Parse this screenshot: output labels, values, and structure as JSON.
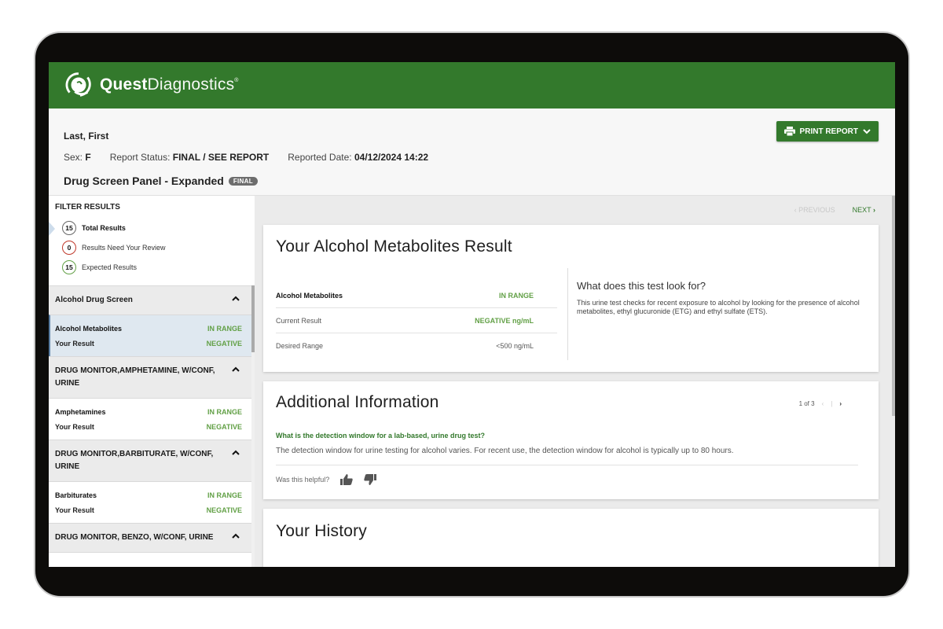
{
  "brand": {
    "name_bold": "Quest",
    "name_light": "Diagnostics",
    "trademark": "®",
    "primary_color": "#33792c",
    "in_range_color": "#62a046"
  },
  "patient": {
    "name": "Last, First",
    "sex_label": "Sex:",
    "sex_value": "F",
    "status_label": "Report Status:",
    "status_value": "FINAL / SEE REPORT",
    "date_label": "Reported Date:",
    "date_value": "04/12/2024 14:22",
    "panel_title": "Drug Screen Panel - Expanded",
    "panel_badge": "FINAL"
  },
  "toolbar": {
    "print_label": "PRINT REPORT",
    "print_icon": "printer-icon",
    "dropdown_icon": "chevron-down-icon"
  },
  "filters": {
    "title": "FILTER RESULTS",
    "items": [
      {
        "count": "15",
        "label": "Total Results",
        "ring": "#666666",
        "active": true
      },
      {
        "count": "0",
        "label": "Results Need Your Review",
        "ring": "#c0392b",
        "active": false
      },
      {
        "count": "15",
        "label": "Expected Results",
        "ring": "#62a046",
        "active": false
      }
    ]
  },
  "sidebar": {
    "groups": [
      {
        "title": "Alcohol Drug Screen",
        "result": {
          "name": "Alcohol Metabolites",
          "status": "IN RANGE",
          "your_result_label": "Your Result",
          "value": "NEGATIVE"
        }
      },
      {
        "title": "DRUG MONITOR,AMPHETAMINE, W/CONF, URINE",
        "result": {
          "name": "Amphetamines",
          "status": "IN RANGE",
          "your_result_label": "Your Result",
          "value": "NEGATIVE"
        }
      },
      {
        "title": "DRUG MONITOR,BARBITURATE, W/CONF, URINE",
        "result": {
          "name": "Barbiturates",
          "status": "IN RANGE",
          "your_result_label": "Your Result",
          "value": "NEGATIVE"
        }
      },
      {
        "title": "DRUG MONITOR, BENZO, W/CONF, URINE"
      }
    ]
  },
  "pager": {
    "previous": "PREVIOUS",
    "next": "NEXT"
  },
  "result_card": {
    "title": "Your Alcohol Metabolites Result",
    "rows": [
      {
        "label": "Alcohol Metabolites",
        "value": "IN RANGE"
      },
      {
        "label": "Current Result",
        "value": "NEGATIVE ng/mL"
      },
      {
        "label": "Desired Range",
        "value": "<500 ng/mL"
      }
    ],
    "info_title": "What does this test look for?",
    "info_text": "This urine test checks for recent exposure to alcohol by looking for the presence of alcohol metabolites, ethyl glucuronide (ETG) and ethyl sulfate (ETS)."
  },
  "additional": {
    "title": "Additional Information",
    "page_indicator": "1 of 3",
    "question": "What is the detection window for a lab-based, urine drug test?",
    "answer": "The detection window for urine testing for alcohol varies. For recent use, the detection window for alcohol is typically up to 80 hours.",
    "helpful_label": "Was this helpful?"
  },
  "history": {
    "title": "Your History"
  }
}
